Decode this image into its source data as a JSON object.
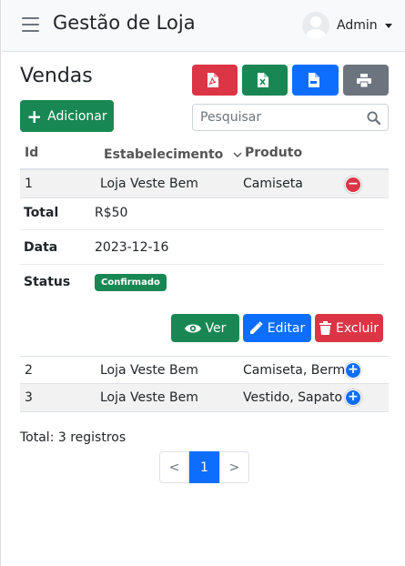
{
  "navbar": {
    "brand": "Gestão de Loja",
    "user_name": "Admin"
  },
  "page": {
    "title": "Vendas"
  },
  "toolbar": {
    "add_label": "Adicionar",
    "search_placeholder": "Pesquisar"
  },
  "table": {
    "headers": {
      "id": "Id",
      "establishment": "Estabelecimento",
      "product": "Produto"
    },
    "rows": [
      {
        "id": "1",
        "establishment": "Loja Veste Bem",
        "product": "Camiseta"
      },
      {
        "id": "2",
        "establishment": "Loja Veste Bem",
        "product": "Camiseta, Bermuda"
      },
      {
        "id": "3",
        "establishment": "Loja Veste Bem",
        "product": "Vestido, Sapato"
      }
    ],
    "details": {
      "total_label": "Total",
      "total_value": "R$50",
      "date_label": "Data",
      "date_value": "2023-12-16",
      "status_label": "Status",
      "status_value": "Confirmado"
    },
    "actions": {
      "view": "Ver",
      "edit": "Editar",
      "delete": "Excluir"
    }
  },
  "footer": {
    "total_records": "Total: 3 registros"
  },
  "pagination": {
    "prev": "<",
    "current": "1",
    "next": ">"
  },
  "colors": {
    "success": "#198754",
    "danger": "#dc3545",
    "primary": "#0d6efd",
    "secondary": "#6c757d"
  },
  "icons": [
    "menu-icon",
    "user-avatar-icon",
    "file-pdf-icon",
    "file-excel-icon",
    "file-csv-icon",
    "print-icon",
    "plus-icon",
    "search-icon",
    "sort-icon",
    "collapse-icon",
    "expand-icon",
    "eye-icon",
    "pencil-icon",
    "trash-icon"
  ]
}
